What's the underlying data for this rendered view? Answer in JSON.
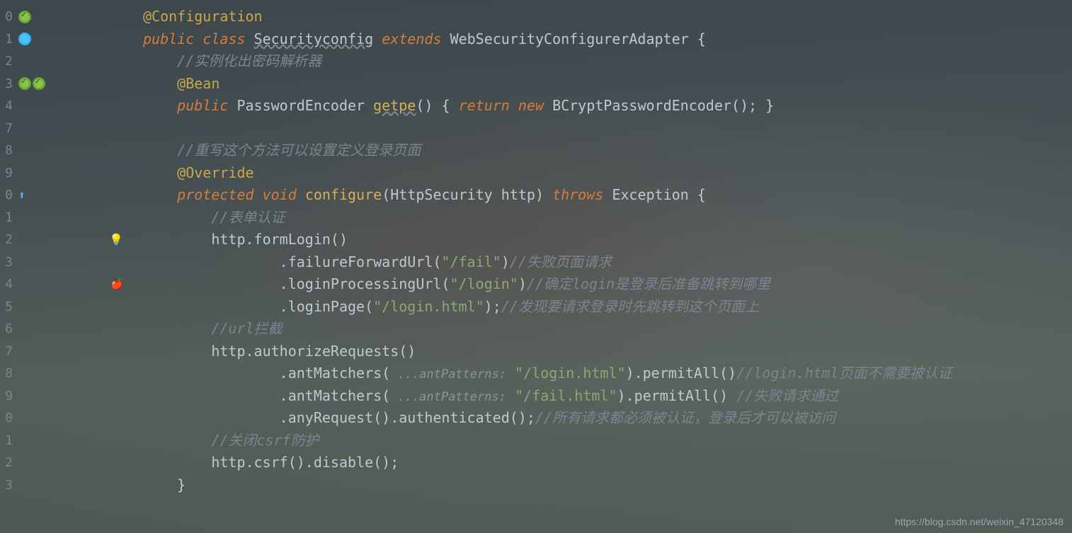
{
  "lineNumbers": [
    "0",
    "1",
    "2",
    "3",
    "4",
    "7",
    "8",
    "9",
    "0",
    "1",
    "2",
    "3",
    "4",
    "5",
    "6",
    "7",
    "8",
    "9",
    "0",
    "1",
    "2",
    "3"
  ],
  "code": {
    "l0": {
      "annotation": "@Configuration"
    },
    "l1": {
      "kw1": "public",
      "kw2": "class",
      "name": "Securityconfig",
      "kw3": "extends",
      "parent": "WebSecurityConfigurerAdapter",
      "brace": "{"
    },
    "l2": {
      "comment": "//实例化出密码解析器"
    },
    "l3": {
      "annotation": "@Bean"
    },
    "l4": {
      "kw1": "public",
      "type": "PasswordEncoder",
      "method": "getpe",
      "paren1": "()",
      "brace1": "{",
      "kw2": "return",
      "kw3": "new",
      "ctor": "BCryptPasswordEncoder();",
      "brace2": "}"
    },
    "l5": {},
    "l6": {
      "comment": "//重写这个方法可以设置定义登录页面"
    },
    "l7": {
      "annotation": "@Override"
    },
    "l8": {
      "kw1": "protected",
      "kw2": "void",
      "method": "configure",
      "paren1": "(",
      "type": "HttpSecurity",
      "param": "http",
      "paren2": ")",
      "kw3": "throws",
      "exc": "Exception",
      "brace": "{"
    },
    "l9": {
      "comment": "//表单认证"
    },
    "l10": {
      "obj": "http",
      "method": ".formLogin()"
    },
    "l11": {
      "method": ".failureForwardUrl(",
      "str": "\"/fail\"",
      "paren": ")",
      "comment": "//失败页面请求"
    },
    "l12": {
      "method": ".loginProcessingUrl(",
      "str": "\"/login\"",
      "paren": ")",
      "comment": "//确定login是登录后准备跳转到哪里"
    },
    "l13": {
      "method": ".loginPage(",
      "str": "\"/login.html\"",
      "paren": ");",
      "comment": "//发现要请求登录时先跳转到这个页面上"
    },
    "l14": {
      "comment": "//url拦截"
    },
    "l15": {
      "obj": "http",
      "method": ".authorizeRequests()"
    },
    "l16": {
      "method": ".antMatchers(",
      "hint": " ...antPatterns:",
      "str": "\"/login.html\"",
      "paren": ").permitAll()",
      "comment": "//login.html页面不需要被认证"
    },
    "l17": {
      "method": ".antMatchers(",
      "hint": " ...antPatterns:",
      "str": "\"/fail.html\"",
      "paren": ").permitAll() ",
      "comment": "//失败请求通过"
    },
    "l18": {
      "method": ".anyRequest().authenticated();",
      "comment": "//所有请求都必须被认证，登录后才可以被访问"
    },
    "l19": {
      "comment": "//关闭csrf防护"
    },
    "l20": {
      "obj": "http",
      "method": ".csrf().disable();"
    },
    "l21": {
      "brace": "}"
    }
  },
  "watermark": "https://blog.csdn.net/weixin_47120348"
}
